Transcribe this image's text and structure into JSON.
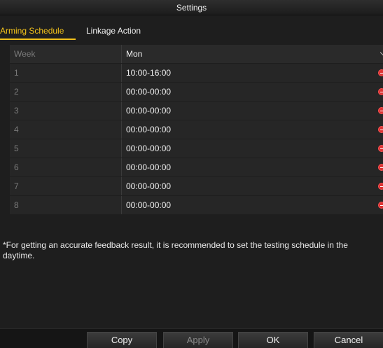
{
  "window": {
    "title": "Settings"
  },
  "tabs": [
    {
      "label": "Arming Schedule",
      "active": true
    },
    {
      "label": "Linkage Action",
      "active": false
    }
  ],
  "table": {
    "header": {
      "label": "Week",
      "value": "Mon"
    },
    "rows": [
      {
        "index": "1",
        "time": "10:00-16:00"
      },
      {
        "index": "2",
        "time": "00:00-00:00"
      },
      {
        "index": "3",
        "time": "00:00-00:00"
      },
      {
        "index": "4",
        "time": "00:00-00:00"
      },
      {
        "index": "5",
        "time": "00:00-00:00"
      },
      {
        "index": "6",
        "time": "00:00-00:00"
      },
      {
        "index": "7",
        "time": "00:00-00:00"
      },
      {
        "index": "8",
        "time": "00:00-00:00"
      }
    ]
  },
  "note": "*For getting an accurate feedback result, it is recommended to set the testing schedule in the daytime.",
  "buttons": {
    "copy": "Copy",
    "apply": "Apply",
    "ok": "OK",
    "cancel": "Cancel"
  },
  "colors": {
    "accent": "#f3c21b",
    "delete_icon": "#dd3333"
  }
}
